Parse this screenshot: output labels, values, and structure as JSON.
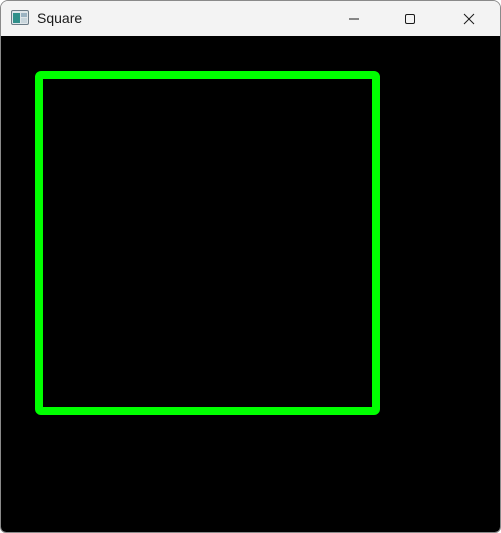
{
  "window": {
    "title": "Square",
    "app_icon": "window-app-icon",
    "controls": {
      "minimize_icon": "minimize-icon",
      "maximize_icon": "maximize-icon",
      "close_icon": "close-icon"
    }
  },
  "canvas": {
    "background_color": "#000000",
    "shape": {
      "type": "square",
      "color": "#00ff00"
    }
  }
}
